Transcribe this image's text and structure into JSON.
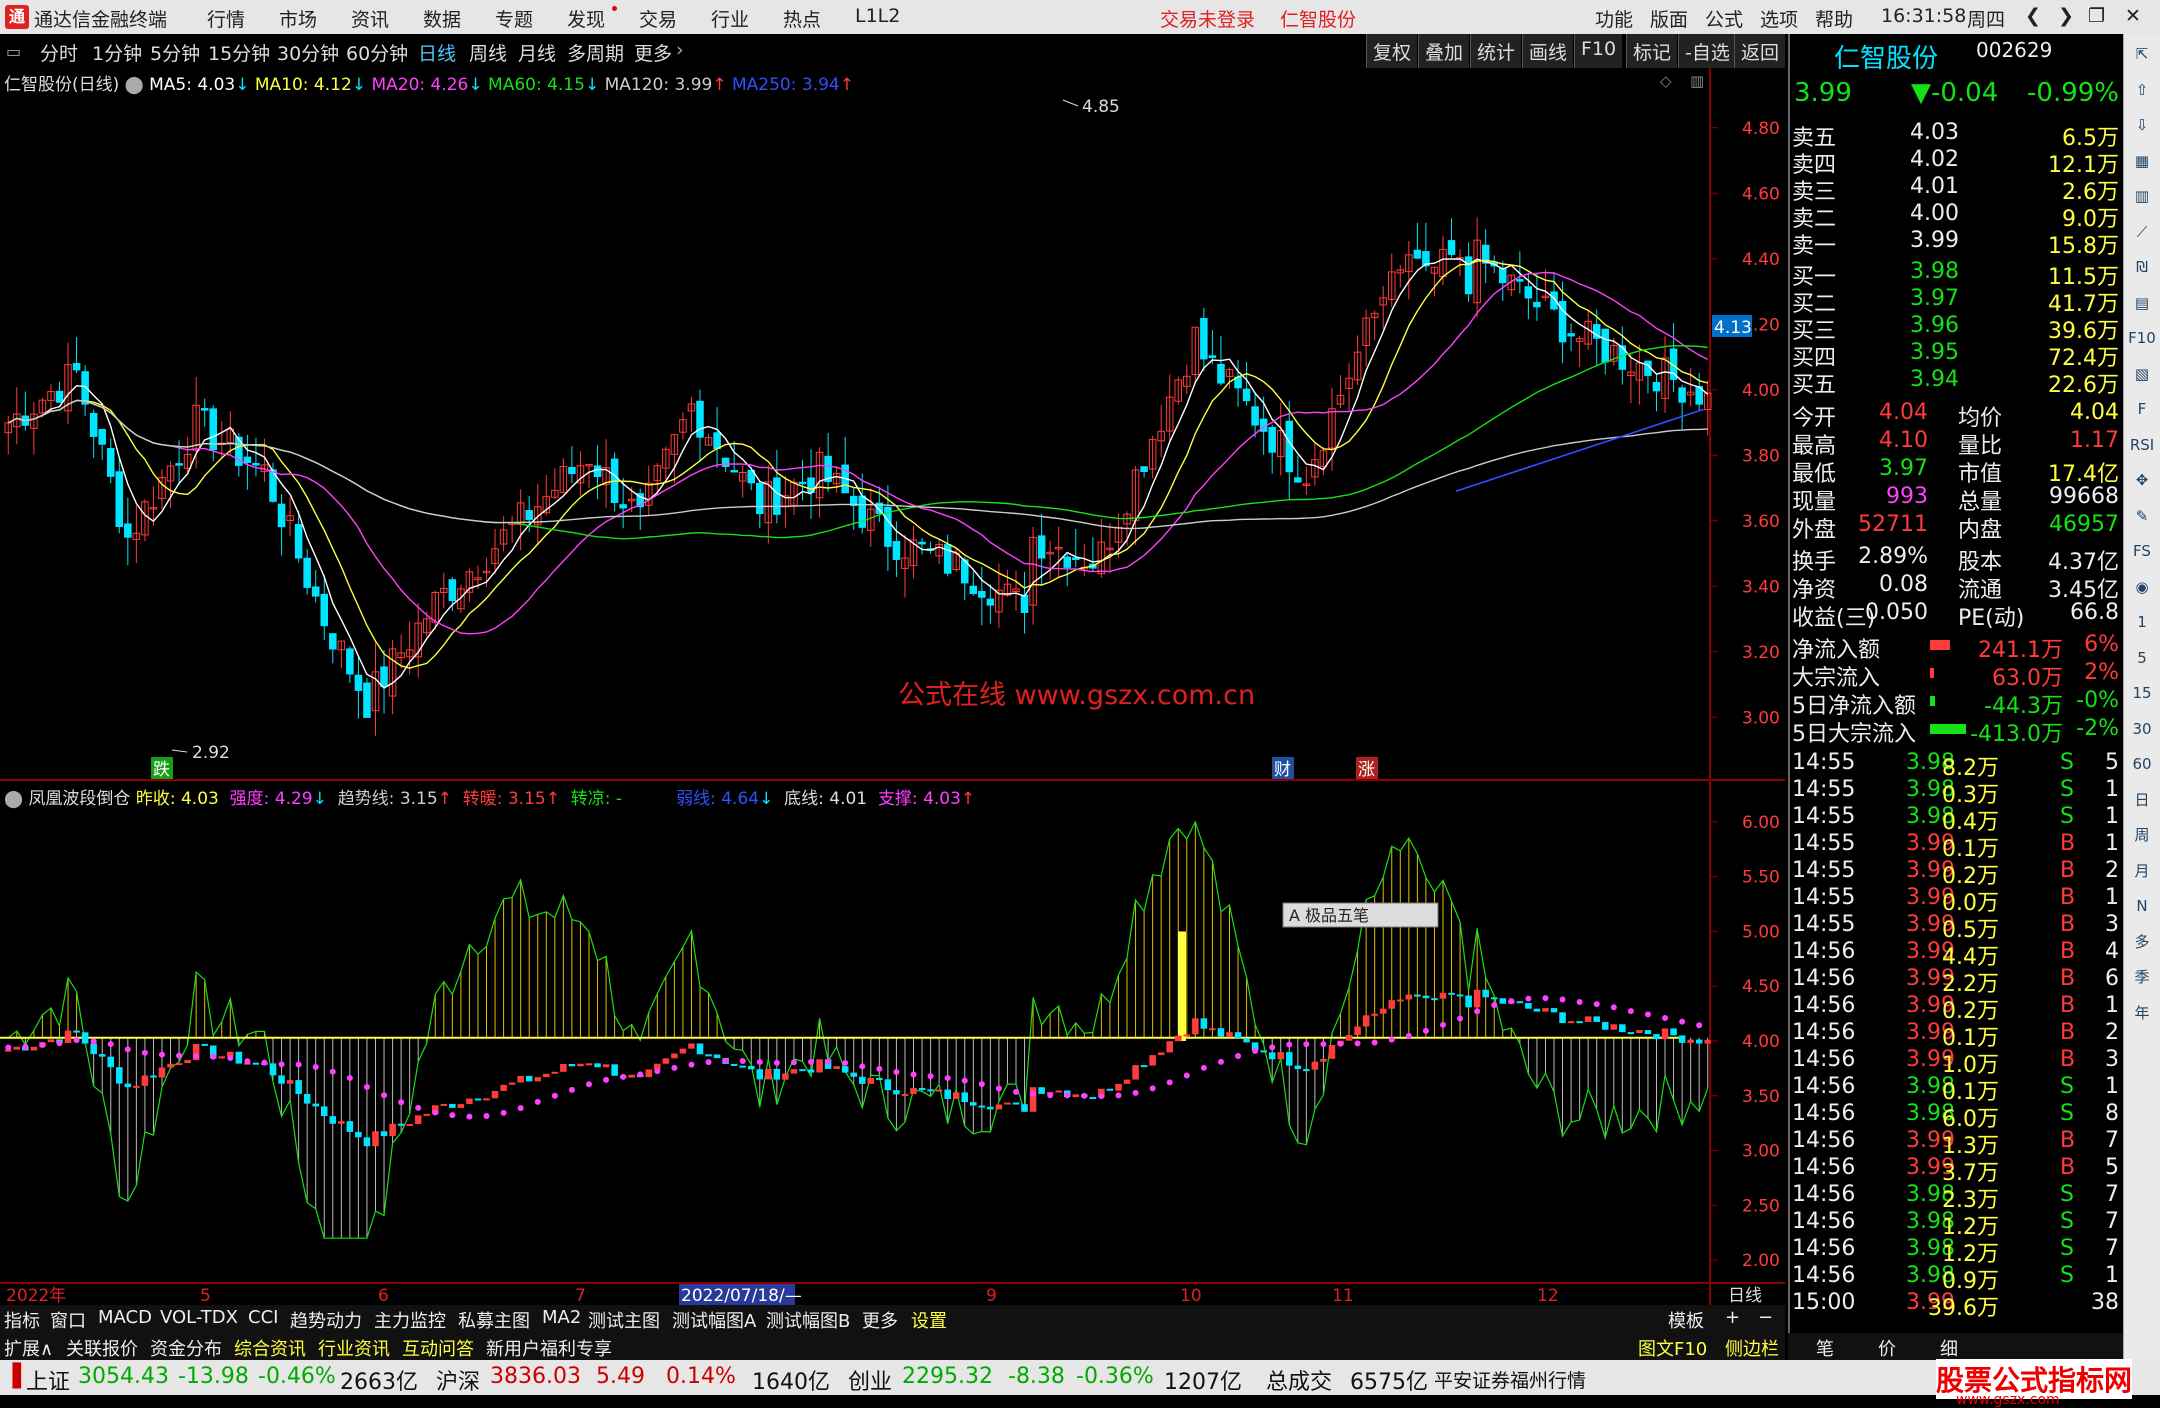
{
  "titlebar": {
    "app_name": "通达信金融终端",
    "menu": [
      "行情",
      "市场",
      "资讯",
      "数据",
      "专题",
      "发现",
      "交易",
      "行业",
      "热点",
      "L1L2"
    ],
    "login_status": "交易未登录",
    "stock_title": "仁智股份",
    "right_menu": [
      "功能",
      "版面",
      "公式",
      "选项",
      "帮助"
    ],
    "time": "16:31:58",
    "weekday": "周四"
  },
  "period_tabs": [
    "分时",
    "1分钟",
    "5分钟",
    "15分钟",
    "30分钟",
    "60分钟",
    "日线",
    "周线",
    "月线",
    "多周期",
    "更多"
  ],
  "chart_tools": [
    "复权",
    "叠加",
    "统计",
    "画线",
    "F10",
    "标记",
    "-自选",
    "返回"
  ],
  "ma_legend": {
    "name": "仁智股份(日线)",
    "ma5": "MA5: 4.03",
    "ma10": "MA10: 4.12",
    "ma20": "MA20: 4.26",
    "ma60": "MA60: 4.15",
    "ma120": "MA120: 3.99",
    "ma250": "MA250: 3.94"
  },
  "main_axis": [
    "4.80",
    "4.60",
    "4.40",
    "4.20",
    "4.00",
    "3.80",
    "3.60",
    "3.40",
    "3.20",
    "3.00"
  ],
  "price_tag": "4.13",
  "high_label": "4.85",
  "low_label": "2.92",
  "markers": {
    "die": "跌",
    "cai": "财",
    "zhang": "涨"
  },
  "watermark": "公式在线  www.gszx.com.cn",
  "ind_legend": {
    "name": "凤凰波段倒仓",
    "zuoshou": "昨收: 4.03",
    "qiangdu": "强度: 4.29",
    "qushixian": "趋势线: 3.15",
    "zhuannuan": "转暖: 3.15",
    "zhuanliang": "转凉: -",
    "ruoxian": "弱线: 4.64",
    "dixian": "底线: 4.01",
    "zhicheng": "支撑: 4.03"
  },
  "ind_axis": [
    "6.00",
    "5.50",
    "5.00",
    "4.50",
    "4.00",
    "3.50",
    "3.00",
    "2.50",
    "2.00"
  ],
  "ime_box": "A 极品五笔",
  "date_axis": {
    "year": "2022年",
    "m5": "5",
    "m6": "6",
    "m7": "7",
    "cursor_date": "2022/07/18/—",
    "m9": "9",
    "m10": "10",
    "m11": "11",
    "m12": "12",
    "period": "日线"
  },
  "bottom_tabs": [
    "指标",
    "窗口",
    "MACD",
    "VOL-TDX",
    "CCI",
    "趋势动力",
    "主力监控",
    "私募主图",
    "MA2",
    "测试主图",
    "测试幅图A",
    "测试幅图B",
    "更多",
    "设置"
  ],
  "bottom_right": [
    "模板",
    "+",
    "−"
  ],
  "bottom_tabs2": [
    "扩展∧",
    "关联报价",
    "资金分布",
    "综合资讯",
    "行业资讯",
    "互动问答",
    "新用户福利专享"
  ],
  "bottom_tabs2_right": [
    "图文F10",
    "侧边栏《",
    "笔",
    "价",
    "细"
  ],
  "quote": {
    "name": "仁智股份",
    "code": "002629",
    "price": "3.99",
    "change": "▼-0.04",
    "pct": "-0.99%",
    "asks": [
      {
        "label": "卖五",
        "price": "4.03",
        "vol": "6.5万"
      },
      {
        "label": "卖四",
        "price": "4.02",
        "vol": "12.1万"
      },
      {
        "label": "卖三",
        "price": "4.01",
        "vol": "2.6万"
      },
      {
        "label": "卖二",
        "price": "4.00",
        "vol": "9.0万"
      },
      {
        "label": "卖一",
        "price": "3.99",
        "vol": "15.8万"
      }
    ],
    "bids": [
      {
        "label": "买一",
        "price": "3.98",
        "vol": "11.5万"
      },
      {
        "label": "买二",
        "price": "3.97",
        "vol": "41.7万"
      },
      {
        "label": "买三",
        "price": "3.96",
        "vol": "39.6万"
      },
      {
        "label": "买四",
        "price": "3.95",
        "vol": "72.4万"
      },
      {
        "label": "买五",
        "price": "3.94",
        "vol": "22.6万"
      }
    ],
    "stats": [
      [
        "今开",
        "4.04",
        "均价",
        "4.04"
      ],
      [
        "最高",
        "4.10",
        "量比",
        "1.17"
      ],
      [
        "最低",
        "3.97",
        "市值",
        "17.4亿"
      ],
      [
        "现量",
        "993",
        "总量",
        "99668"
      ],
      [
        "外盘",
        "52711",
        "内盘",
        "46957"
      ]
    ],
    "stats2": [
      [
        "换手",
        "2.89%",
        "股本",
        "4.37亿"
      ],
      [
        "净资",
        "0.08",
        "流通",
        "3.45亿"
      ],
      [
        "收益(三)",
        "0.050",
        "PE(动)",
        "66.8"
      ]
    ],
    "flows": [
      [
        "净流入额",
        "241.1万",
        "6%"
      ],
      [
        "大宗流入",
        "63.0万",
        "2%"
      ],
      [
        "5日净流入额",
        "-44.3万",
        "-0%"
      ],
      [
        "5日大宗流入",
        "-413.0万",
        "-2%"
      ]
    ],
    "ticks": [
      [
        "14:55",
        "3.98",
        "8.2万",
        "S",
        "5"
      ],
      [
        "14:55",
        "3.98",
        "0.3万",
        "S",
        "1"
      ],
      [
        "14:55",
        "3.98",
        "0.4万",
        "S",
        "1"
      ],
      [
        "14:55",
        "3.99",
        "0.1万",
        "B",
        "1"
      ],
      [
        "14:55",
        "3.99",
        "0.2万",
        "B",
        "2"
      ],
      [
        "14:55",
        "3.99",
        "0.0万",
        "B",
        "1"
      ],
      [
        "14:55",
        "3.99",
        "0.5万",
        "B",
        "3"
      ],
      [
        "14:56",
        "3.99",
        "4.4万",
        "B",
        "4"
      ],
      [
        "14:56",
        "3.99",
        "2.2万",
        "B",
        "6"
      ],
      [
        "14:56",
        "3.99",
        "0.2万",
        "B",
        "1"
      ],
      [
        "14:56",
        "3.99",
        "0.1万",
        "B",
        "2"
      ],
      [
        "14:56",
        "3.99",
        "1.0万",
        "B",
        "3"
      ],
      [
        "14:56",
        "3.98",
        "0.1万",
        "S",
        "1"
      ],
      [
        "14:56",
        "3.98",
        "6.0万",
        "S",
        "8"
      ],
      [
        "14:56",
        "3.99",
        "1.3万",
        "B",
        "7"
      ],
      [
        "14:56",
        "3.99",
        "3.7万",
        "B",
        "5"
      ],
      [
        "14:56",
        "3.98",
        "2.3万",
        "S",
        "7"
      ],
      [
        "14:56",
        "3.98",
        "1.2万",
        "S",
        "7"
      ],
      [
        "14:56",
        "3.98",
        "1.2万",
        "S",
        "7"
      ],
      [
        "14:56",
        "3.98",
        "0.9万",
        "S",
        "1"
      ],
      [
        "15:00",
        "3.99",
        "39.6万",
        "",
        "38"
      ]
    ]
  },
  "side_tools": [
    "⇱",
    "⇧",
    "⇩",
    "▦",
    "▥",
    "⟋",
    "₪",
    "▤",
    "F10",
    "▧",
    "F",
    "RSI",
    "✥",
    "✎",
    "FS",
    "◉",
    "1",
    "5",
    "15",
    "30",
    "60",
    "日",
    "周",
    "月",
    "N",
    "多",
    "季",
    "年"
  ],
  "statusbar": {
    "idx1_name": "上证",
    "idx1_val": "3054.43",
    "idx1_chg": "-13.98",
    "idx1_pct": "-0.46%",
    "idx1_amt": "2663亿",
    "idx2_name": "沪深",
    "idx2_val": "3836.03",
    "idx2_chg": "5.49",
    "idx2_pct": "0.14%",
    "idx2_amt": "1640亿",
    "idx3_name": "创业",
    "idx3_val": "2295.32",
    "idx3_chg": "-8.38",
    "idx3_pct": "-0.36%",
    "idx3_amt": "1207亿",
    "total_label": "总成交",
    "total_val": "6575亿",
    "broker": "平安证券福州行情",
    "brand": "股票公式指标网",
    "brand_url": "www.gszx.com"
  },
  "colors": {
    "up": "#ff3b3b",
    "down": "#00e5ff",
    "ma5": "#ffffff",
    "ma10": "#ffff40",
    "ma20": "#ff40ff",
    "ma60": "#16e016",
    "ma120": "#cccccc",
    "ma250": "#3050ff"
  }
}
